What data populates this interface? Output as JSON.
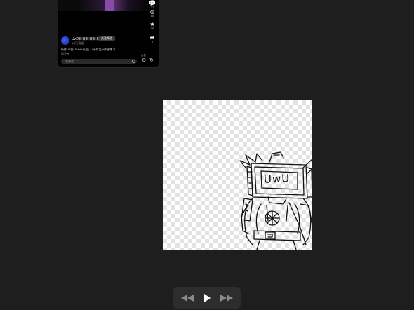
{
  "phone": {
    "username": "Uw2日日日日日日日 ✓",
    "follow_label": "关注频道",
    "user_sub": "1.2万粉丝",
    "caption": "新作UR分「UwU表达」 #小作品 #作画练习",
    "caption_sub": "展开 ▾",
    "comment_placeholder": "发弹幕",
    "side_counts": [
      "37",
      "65",
      "158",
      "0"
    ],
    "bottom_label": "合集"
  },
  "canvas": {
    "screen_text": "UwU"
  },
  "controls": {
    "rewind_icon": "rewind-icon",
    "play_icon": "play-icon",
    "forward_icon": "fast-forward-icon"
  },
  "colors": {
    "background": "#1e1e1e",
    "controls_bg": "#2d2d2d",
    "icon_inactive": "#8a8a8a",
    "icon_active": "#ffffff"
  }
}
